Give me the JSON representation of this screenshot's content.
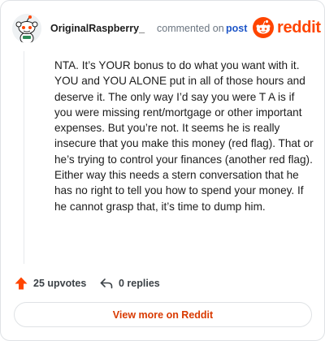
{
  "header": {
    "author": "OriginalRaspberry_",
    "action_text": "commented on",
    "post_link": "post",
    "brand_name": "reddit",
    "brand_color": "#ff4500"
  },
  "comment": {
    "text": "NTA. It’s YOUR bonus to do what you want with it. YOU and YOU ALONE put in all of those hours and deserve it. The only way I’d say you were T A is if you were missing rent/mortgage or other important expenses. But you’re not. It seems he is really insecure that you make this money (red flag). That or he’s trying to control your finances (another red flag). Either way this needs a stern conversation that he has no right to tell you how to spend your money. If he cannot grasp that, it’s time to dump him."
  },
  "footer": {
    "upvotes_label": "25 upvotes",
    "replies_label": "0 replies",
    "upvote_icon": "upvote-arrow-icon",
    "reply_icon": "reply-arrow-icon",
    "upvote_color": "#ff4500"
  },
  "view_more": {
    "label": "View more on Reddit",
    "color": "#d93a00"
  }
}
